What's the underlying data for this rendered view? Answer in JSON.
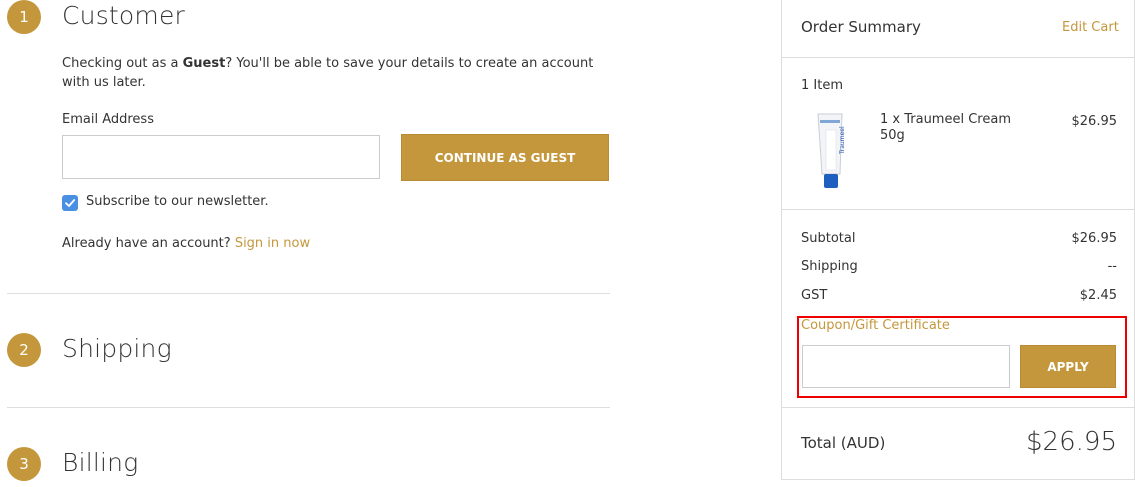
{
  "steps": [
    {
      "number": "1",
      "title": "Customer"
    },
    {
      "number": "2",
      "title": "Shipping"
    },
    {
      "number": "3",
      "title": "Billing"
    }
  ],
  "customer": {
    "intro_pre": "Checking out as a ",
    "intro_bold": "Guest",
    "intro_post": "? You'll be able to save your details to create an account with us later.",
    "email_label": "Email Address",
    "email_value": "",
    "continue_label": "CONTINUE AS GUEST",
    "newsletter_label": "Subscribe to our newsletter.",
    "newsletter_checked": true,
    "account_prompt": "Already have an account?",
    "signin_label": "Sign in now"
  },
  "summary": {
    "title": "Order Summary",
    "edit_cart": "Edit Cart",
    "items_count": "1 Item",
    "items": [
      {
        "name": "1 x Traumeel Cream 50g",
        "price": "$26.95",
        "image_text": "Traumeel"
      }
    ],
    "rows": [
      {
        "label": "Subtotal",
        "value": "$26.95"
      },
      {
        "label": "Shipping",
        "value": "--"
      },
      {
        "label": "GST",
        "value": "$2.45"
      }
    ],
    "coupon_label": "Coupon/Gift Certificate",
    "coupon_value": "",
    "apply_label": "APPLY",
    "total_label": "Total (AUD)",
    "total_value": "$26.95"
  },
  "colors": {
    "accent": "#c4973c",
    "checkbox": "#4a90e2",
    "highlight_border": "#ee0000"
  }
}
